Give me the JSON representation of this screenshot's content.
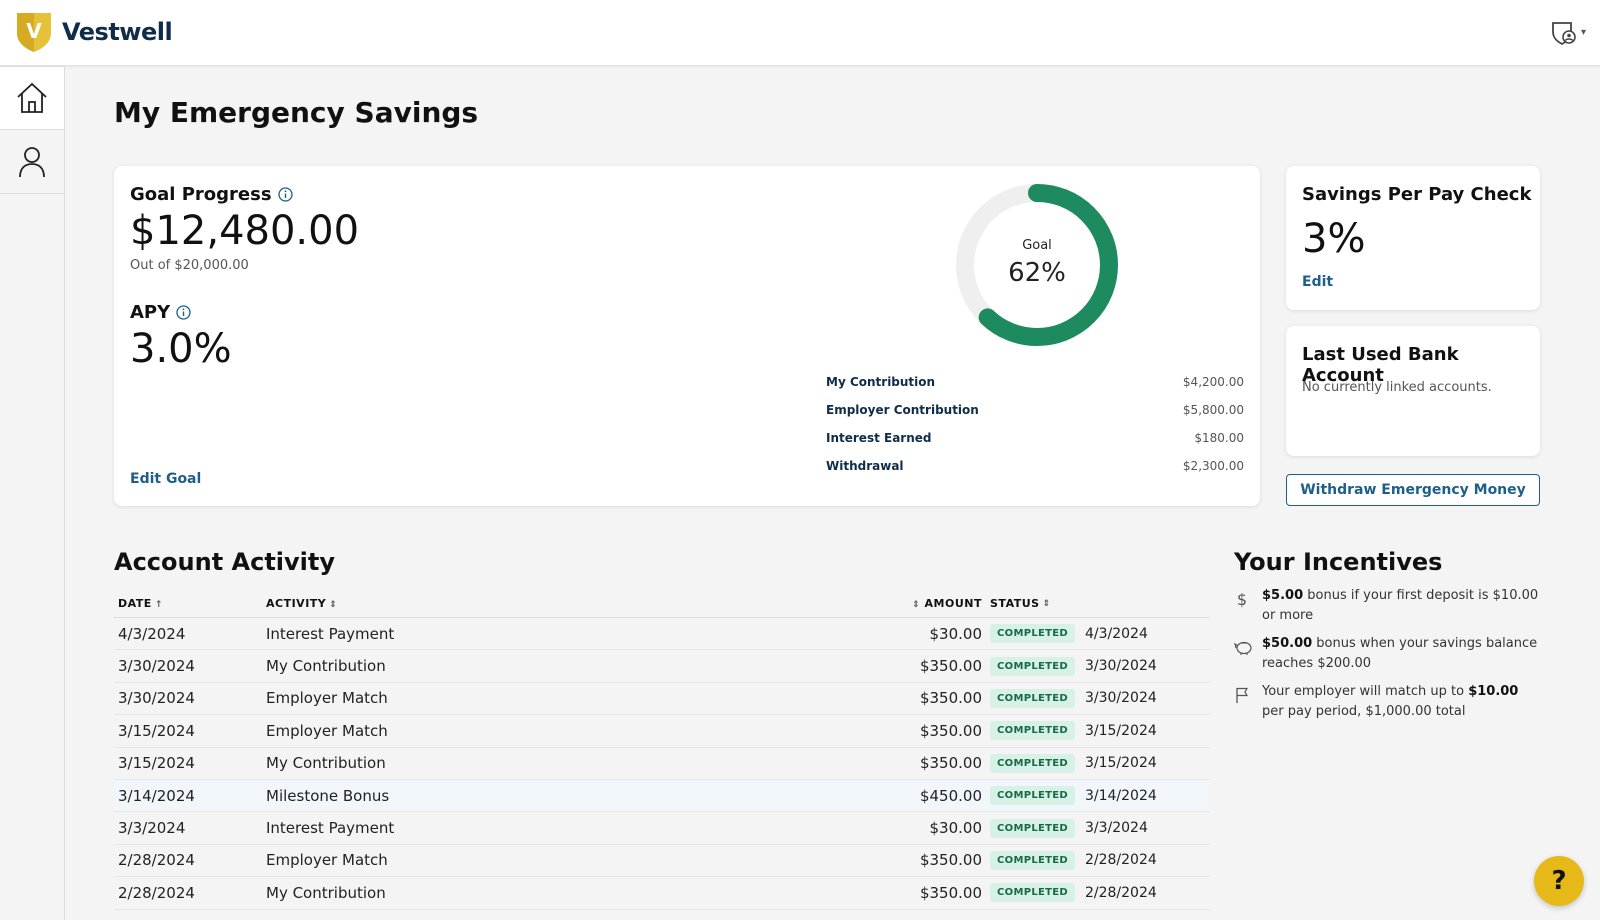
{
  "brand": {
    "name": "Vestwell",
    "logo_letter": "V"
  },
  "header": {
    "user_icon": "shield-user-icon",
    "caret": "▾"
  },
  "sidebar": {
    "items": [
      {
        "name": "home",
        "icon": "home-icon"
      },
      {
        "name": "profile",
        "icon": "user-icon"
      }
    ]
  },
  "page": {
    "title": "My Emergency Savings"
  },
  "goal": {
    "title": "Goal Progress",
    "amount": "$12,480.00",
    "out_of": "Out of $20,000.00",
    "apy_title": "APY",
    "apy_value": "3.0%",
    "edit_label": "Edit Goal",
    "donut_label": "Goal",
    "donut_percent": "62%",
    "progress_fraction": 0.62,
    "breakdown": [
      {
        "label": "My Contribution",
        "value": "$4,200.00"
      },
      {
        "label": "Employer Contribution",
        "value": "$5,800.00"
      },
      {
        "label": "Interest Earned",
        "value": "$180.00"
      },
      {
        "label": "Withdrawal",
        "value": "$2,300.00"
      }
    ]
  },
  "savings_per_paycheck": {
    "title": "Savings Per Pay Check",
    "value": "3%",
    "edit_label": "Edit"
  },
  "bank": {
    "title": "Last Used Bank Account",
    "text": "No currently linked accounts."
  },
  "withdraw_label": "Withdraw Emergency Money",
  "activity": {
    "title": "Account Activity",
    "columns": {
      "date": "DATE",
      "activity": "ACTIVITY",
      "amount": "AMOUNT",
      "status": "STATUS"
    },
    "rows": [
      {
        "date": "4/3/2024",
        "activity": "Interest Payment",
        "amount": "$30.00",
        "status": "COMPLETED",
        "status_date": "4/3/2024"
      },
      {
        "date": "3/30/2024",
        "activity": "My Contribution",
        "amount": "$350.00",
        "status": "COMPLETED",
        "status_date": "3/30/2024"
      },
      {
        "date": "3/30/2024",
        "activity": "Employer Match",
        "amount": "$350.00",
        "status": "COMPLETED",
        "status_date": "3/30/2024"
      },
      {
        "date": "3/15/2024",
        "activity": "Employer Match",
        "amount": "$350.00",
        "status": "COMPLETED",
        "status_date": "3/15/2024"
      },
      {
        "date": "3/15/2024",
        "activity": "My Contribution",
        "amount": "$350.00",
        "status": "COMPLETED",
        "status_date": "3/15/2024"
      },
      {
        "date": "3/14/2024",
        "activity": "Milestone Bonus",
        "amount": "$450.00",
        "status": "COMPLETED",
        "status_date": "3/14/2024"
      },
      {
        "date": "3/3/2024",
        "activity": "Interest Payment",
        "amount": "$30.00",
        "status": "COMPLETED",
        "status_date": "3/3/2024"
      },
      {
        "date": "2/28/2024",
        "activity": "Employer Match",
        "amount": "$350.00",
        "status": "COMPLETED",
        "status_date": "2/28/2024"
      },
      {
        "date": "2/28/2024",
        "activity": "My Contribution",
        "amount": "$350.00",
        "status": "COMPLETED",
        "status_date": "2/28/2024"
      }
    ]
  },
  "incentives": {
    "title": "Your Incentives",
    "items": [
      {
        "icon": "dollar-icon",
        "bold": "$5.00",
        "text": " bonus if your first deposit is $10.00 or more",
        "bold_end": "",
        "text_end": ""
      },
      {
        "icon": "piggy-bank-icon",
        "bold": "$50.00",
        "text": " bonus when your savings balance reaches $200.00",
        "bold_end": "",
        "text_end": ""
      },
      {
        "icon": "flag-icon",
        "bold": "",
        "text": "Your employer will match up to ",
        "bold_end": "$10.00",
        "text_end": " per pay period, $1,000.00 total"
      }
    ]
  },
  "help_label": "?",
  "colors": {
    "brand_navy": "#0f2d4a",
    "accent_blue": "#1d5f8a",
    "donut_green": "#1e8a60",
    "badge_bg": "#d8f1e6",
    "logo_gold": "#e6c23a"
  }
}
